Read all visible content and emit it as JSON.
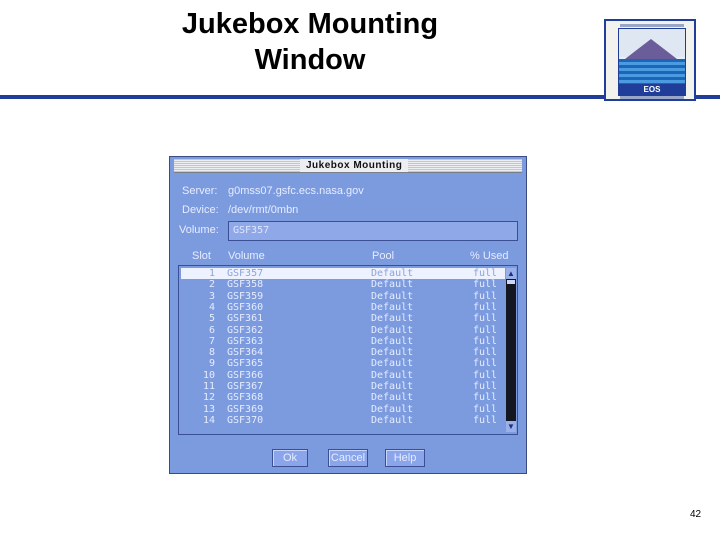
{
  "slide": {
    "title_line1": "Jukebox Mounting",
    "title_line2": "Window",
    "page_number": "42",
    "logo_text": "EOS"
  },
  "dialog": {
    "title": "Jukebox Mounting",
    "server_label": "Server:",
    "server_value": "g0mss07.gsfc.ecs.nasa.gov",
    "device_label": "Device:",
    "device_value": "/dev/rmt/0mbn",
    "volume_label": "Volume:",
    "volume_value": "GSF357",
    "columns": {
      "slot": "Slot",
      "volume": "Volume",
      "pool": "Pool",
      "used": "% Used"
    },
    "rows": [
      {
        "slot": "1",
        "volume": "GSF357",
        "pool": "Default",
        "used": "full"
      },
      {
        "slot": "2",
        "volume": "GSF358",
        "pool": "Default",
        "used": "full"
      },
      {
        "slot": "3",
        "volume": "GSF359",
        "pool": "Default",
        "used": "full"
      },
      {
        "slot": "4",
        "volume": "GSF360",
        "pool": "Default",
        "used": "full"
      },
      {
        "slot": "5",
        "volume": "GSF361",
        "pool": "Default",
        "used": "full"
      },
      {
        "slot": "6",
        "volume": "GSF362",
        "pool": "Default",
        "used": "full"
      },
      {
        "slot": "7",
        "volume": "GSF363",
        "pool": "Default",
        "used": "full"
      },
      {
        "slot": "8",
        "volume": "GSF364",
        "pool": "Default",
        "used": "full"
      },
      {
        "slot": "9",
        "volume": "GSF365",
        "pool": "Default",
        "used": "full"
      },
      {
        "slot": "10",
        "volume": "GSF366",
        "pool": "Default",
        "used": "full"
      },
      {
        "slot": "11",
        "volume": "GSF367",
        "pool": "Default",
        "used": "full"
      },
      {
        "slot": "12",
        "volume": "GSF368",
        "pool": "Default",
        "used": "full"
      },
      {
        "slot": "13",
        "volume": "GSF369",
        "pool": "Default",
        "used": "full"
      },
      {
        "slot": "14",
        "volume": "GSF370",
        "pool": "Default",
        "used": "full"
      }
    ],
    "selected_row": 0,
    "buttons": {
      "ok": "Ok",
      "cancel": "Cancel",
      "help": "Help"
    },
    "icons": {
      "scroll_up": "triangle-up",
      "scroll_down": "triangle-down"
    },
    "colors": {
      "background": "#7c9bdf",
      "text": "#e6ecff",
      "title_rule": "#1f3d99"
    }
  }
}
